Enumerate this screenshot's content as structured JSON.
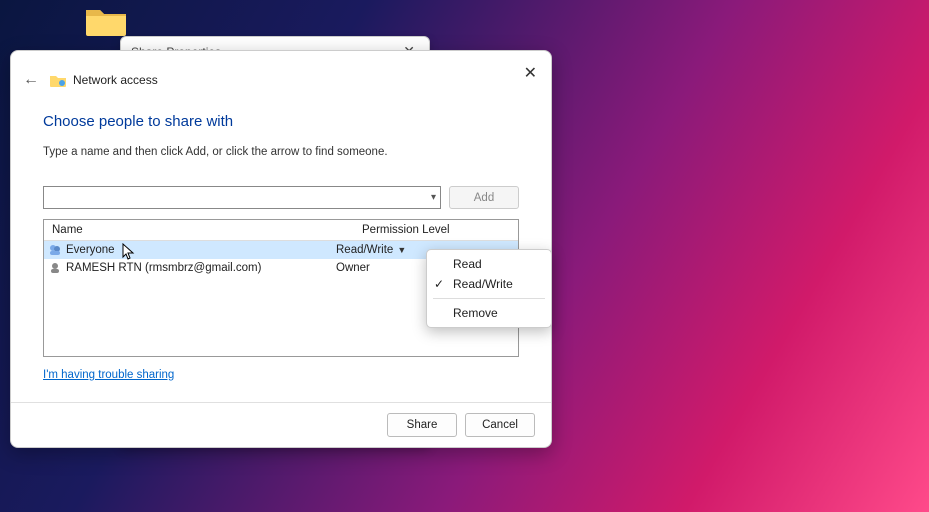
{
  "desktop": {
    "folder_label": ""
  },
  "back_window": {
    "title": "Share Properties"
  },
  "dialog": {
    "title": "Network access",
    "heading": "Choose people to share with",
    "subtext": "Type a name and then click Add, or click the arrow to find someone.",
    "name_input_value": "",
    "add_label": "Add",
    "columns": {
      "name": "Name",
      "perm": "Permission Level"
    },
    "rows": [
      {
        "icon": "group",
        "name": "Everyone",
        "perm": "Read/Write",
        "selected": true,
        "dropdown": true
      },
      {
        "icon": "user",
        "name": "RAMESH RTN (rmsmbrz@gmail.com)",
        "perm": "Owner",
        "selected": false,
        "dropdown": false
      }
    ],
    "trouble_link": "I'm having trouble sharing",
    "share_label": "Share",
    "cancel_label": "Cancel"
  },
  "context_menu": {
    "items": [
      {
        "label": "Read",
        "checked": false
      },
      {
        "label": "Read/Write",
        "checked": true
      }
    ],
    "separator": true,
    "remove_label": "Remove"
  }
}
